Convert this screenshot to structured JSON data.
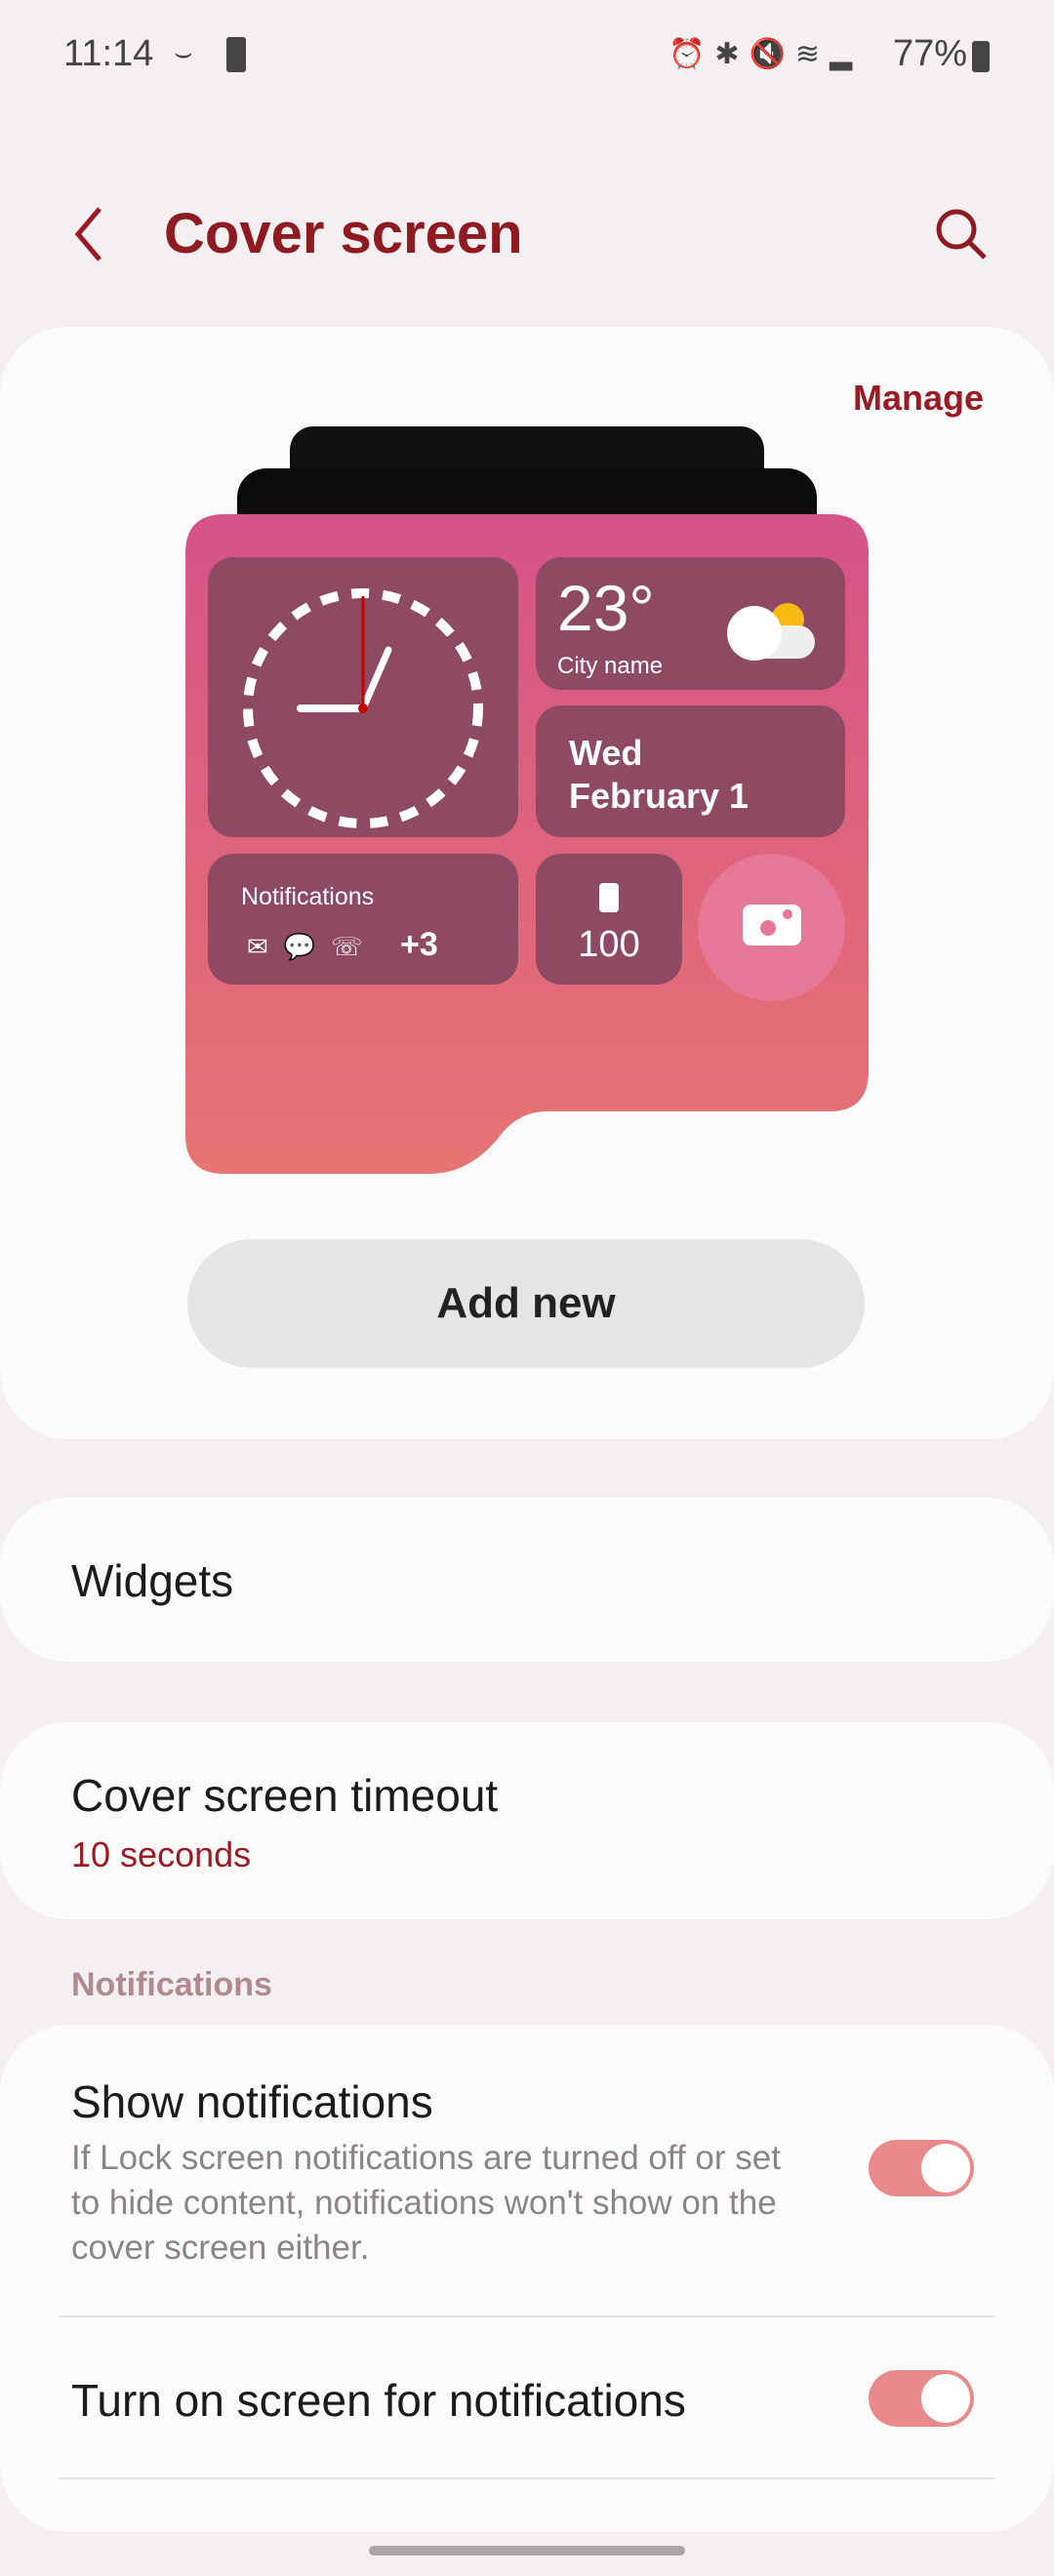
{
  "status_bar": {
    "time": "11:14",
    "battery": "77%"
  },
  "header": {
    "title": "Cover screen"
  },
  "preview": {
    "manage": "Manage",
    "weather_temp": "23°",
    "weather_city": "City name",
    "date_day": "Wed",
    "date_full": "February 1",
    "notifications_label": "Notifications",
    "notifications_more": "+3",
    "battery_value": "100",
    "clock_hour": 11,
    "clock_minute": 45,
    "add_new": "Add new"
  },
  "settings": {
    "widgets": "Widgets",
    "timeout_title": "Cover screen timeout",
    "timeout_value": "10 seconds",
    "section_notifications": "Notifications",
    "show_notifications": {
      "title": "Show notifications",
      "description": "If Lock screen notifications are turned off or set to hide content, notifications won't show on the cover screen either.",
      "enabled": true
    },
    "turn_on_screen": {
      "title": "Turn on screen for notifications",
      "enabled": true
    }
  },
  "colors": {
    "accent": "#9b1b24",
    "toggle": "#e88a8a",
    "background": "#f4eff1"
  }
}
